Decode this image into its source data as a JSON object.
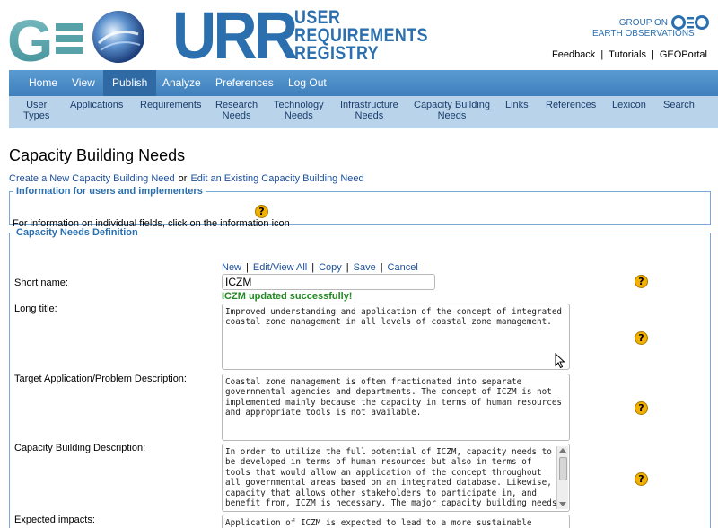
{
  "header": {
    "urr_letters": "URR",
    "urr_words": [
      "USER",
      "REQUIREMENTS",
      "REGISTRY"
    ],
    "group_text": [
      "GROUP ON",
      "EARTH OBSERVATIONS"
    ],
    "top_links": [
      "Feedback",
      "Tutorials",
      "GEOPortal"
    ]
  },
  "main_nav": [
    "Home",
    "View",
    "Publish",
    "Analyze",
    "Preferences",
    "Log Out"
  ],
  "main_nav_active": "Publish",
  "sub_nav": [
    [
      "User",
      "Types"
    ],
    [
      "Applications"
    ],
    [
      "Requirements"
    ],
    [
      "Research",
      "Needs"
    ],
    [
      "Technology",
      "Needs"
    ],
    [
      "Infrastructure",
      "Needs"
    ],
    [
      "Capacity Building",
      "Needs"
    ],
    [
      "Links"
    ],
    [
      "References"
    ],
    [
      "Lexicon"
    ],
    [
      "Search"
    ]
  ],
  "page": {
    "title": "Capacity Building Needs",
    "create_link": "Create a New Capacity Building Need",
    "or": "or",
    "edit_link": "Edit an Existing Capacity Building Need"
  },
  "info_box": {
    "legend": "Information for users and implementers",
    "text": "For information on individual fields, click on the information icon"
  },
  "needs_box": {
    "legend": "Capacity Needs Definition",
    "actions": [
      "New",
      "Edit/View All",
      "Copy",
      "Save",
      "Cancel"
    ],
    "short_name_label": "Short name:",
    "short_name_value": "ICZM",
    "success_message": "ICZM updated successfully!",
    "long_title_label": "Long title:",
    "long_title_value": "Improved understanding and application of the concept of integrated\ncoastal zone management in all levels of coastal zone management.",
    "target_label": "Target Application/Problem Description:",
    "target_value": "Coastal zone management is often fractionated into separate\ngovernmental agencies and departments. The concept of ICZM is not\nimplemented mainly because the capacity in terms of human resources\nand appropriate tools is not available.",
    "capacity_label": "Capacity Building Description:",
    "capacity_value": "In order to utilize the full potential of ICZM, capacity needs to\nbe developed in terms of human resources but also in terms of\ntools that would allow an application of the concept throughout\nall governmental areas based on an integrated database. Likewise,\ncapacity that allows other stakeholders to participate in, and\nbenefit from, ICZM is necessary. The major capacity building needs",
    "expected_label": "Expected impacts:",
    "expected_value": "Application of ICZM is expected to lead to a more sustainable"
  },
  "icons": {
    "info": "?"
  },
  "colors": {
    "nav_blue": "#4a8ac4",
    "subnav_blue": "#b9d3ea",
    "brand_blue": "#2b6fae",
    "success_green": "#1f8a1f",
    "info_icon": "#f2b000"
  }
}
